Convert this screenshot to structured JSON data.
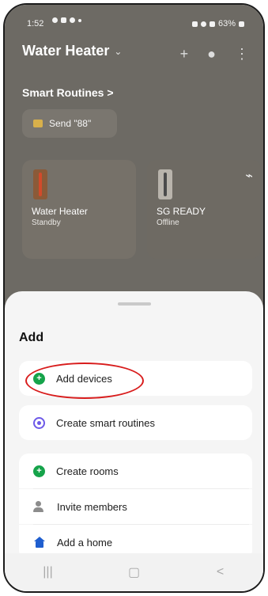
{
  "status_bar": {
    "time": "1:52",
    "battery": "63%"
  },
  "header": {
    "title": "Water Heater",
    "chevron": "⌄",
    "add_icon": "plus-icon",
    "bell_icon": "bell-icon",
    "more_icon": "more-vertical-icon"
  },
  "smart_routines": {
    "title": "Smart Routines",
    "chevron": ">",
    "chip_label": "Send \"88\""
  },
  "devices": [
    {
      "name": "Water Heater",
      "status": "Standby"
    },
    {
      "name": "SG READY",
      "status": "Offline"
    }
  ],
  "sheet": {
    "title": "Add",
    "items": [
      {
        "label": "Add devices"
      },
      {
        "label": "Create smart routines"
      },
      {
        "label": "Create rooms"
      },
      {
        "label": "Invite members"
      },
      {
        "label": "Add a home"
      }
    ]
  },
  "navbar": {
    "recent": "|||",
    "home": "▢",
    "back": "<"
  },
  "colors": {
    "highlight": "#d81c1c",
    "green": "#15a34a",
    "purple": "#6d59e8",
    "house_blue": "#1f5ecf"
  }
}
